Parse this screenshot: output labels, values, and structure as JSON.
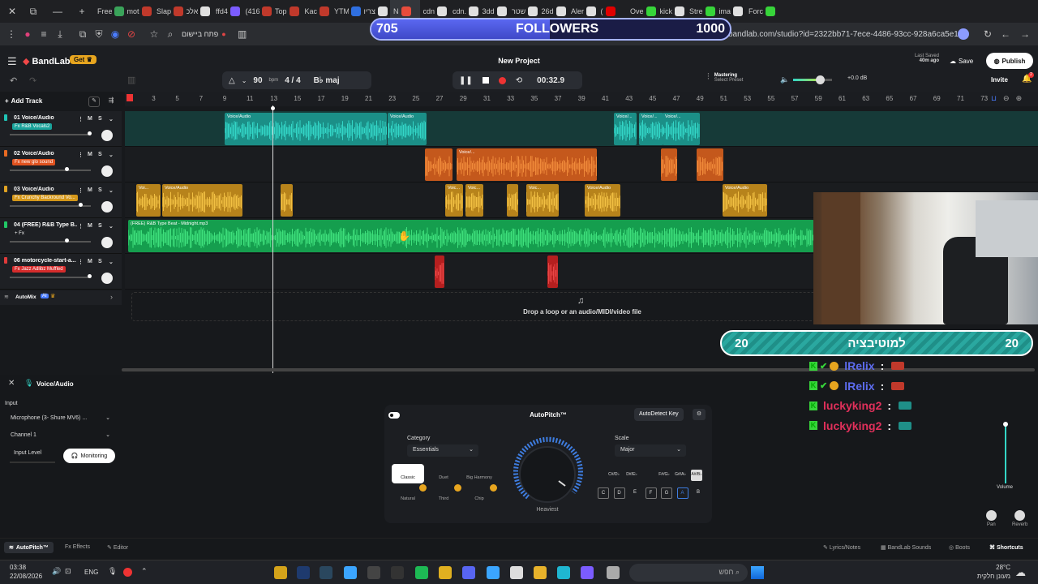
{
  "browser": {
    "tabs": [
      {
        "title": "",
        "color": "#555"
      },
      {
        "title": "",
        "color": "#555"
      },
      {
        "title": "",
        "color": "#555"
      },
      {
        "title": "",
        "color": "#555"
      },
      {
        "title": "Free",
        "color": "#3aa35a"
      },
      {
        "title": "mot",
        "color": "#c0392b"
      },
      {
        "title": "Slap",
        "color": "#c0392b"
      },
      {
        "title": "אלכ",
        "color": "#e0e0e0"
      },
      {
        "title": "ffd4",
        "color": "#7b5cff"
      },
      {
        "title": "(416",
        "color": "#c0392b"
      },
      {
        "title": "Top",
        "color": "#c0392b"
      },
      {
        "title": "Kac",
        "color": "#c0392b"
      },
      {
        "title": "YTM",
        "color": "#2f6fe0"
      },
      {
        "title": "צריו",
        "color": "#e0e0e0"
      },
      {
        "title": "N",
        "color": "#e74c3c"
      },
      {
        "title": "cdn",
        "color": "#e0e0e0"
      },
      {
        "title": "cdn.",
        "color": "#e0e0e0"
      },
      {
        "title": "3dd",
        "color": "#e0e0e0"
      },
      {
        "title": "שטר",
        "color": "#e0e0e0"
      },
      {
        "title": "26d",
        "color": "#e0e0e0"
      },
      {
        "title": "Aler",
        "color": "#e0e0e0"
      },
      {
        "title": "(",
        "color": "#e00000"
      },
      {
        "title": "Ove",
        "color": "#37d43a"
      },
      {
        "title": "kick",
        "color": "#e0e0e0"
      },
      {
        "title": "Stre",
        "color": "#37d43a"
      },
      {
        "title": "ima",
        "color": "#e0e0e0"
      },
      {
        "title": "Forc",
        "color": "#37d43a"
      }
    ],
    "install_app_label": "פתח ביישום",
    "url": "bandlab.com/studio?id=2322bb71-7ece-4486-93cc-928a6ca5e155"
  },
  "followers_overlay": {
    "current": "705",
    "label": "FOLLOWERS",
    "goal": "1000",
    "progress": 0.705
  },
  "header": {
    "logo": "BandLab",
    "get_label": "Get",
    "project_title": "New Project",
    "tempo": "90",
    "tempo_unit": "bpm",
    "time_signature": "4 / 4",
    "key": "B♭ maj",
    "time": "00:32.9",
    "mastering_label": "Mastering",
    "mastering_preset": "Select Preset",
    "volume_db": "+0.0 dB",
    "last_saved_label": "Last Saved",
    "last_saved_time": "40m ago",
    "save_label": "Save",
    "publish_label": "Publish",
    "invite_label": "Invite",
    "notification_count": "2"
  },
  "add_track_label": "Add Track",
  "ruler_marks": [
    "1",
    "3",
    "5",
    "7",
    "9",
    "11",
    "13",
    "15",
    "17",
    "19",
    "21",
    "23",
    "25",
    "27",
    "29",
    "31",
    "33",
    "35",
    "37",
    "39",
    "41",
    "43",
    "45",
    "47",
    "49",
    "51",
    "53",
    "55",
    "57",
    "59",
    "61",
    "63",
    "65",
    "67",
    "69",
    "71",
    "73"
  ],
  "tracks": [
    {
      "name": "01 Voice/Audio",
      "fx": "Fx R&B Vocals2",
      "fx_color": "#1aa39b",
      "color": "#20c4b6",
      "clip_color": "#1b8f87",
      "wave_color": "#33d6c7"
    },
    {
      "name": "02 Voice/Audio",
      "fx": "Fx new glo sound",
      "fx_color": "#e0521f",
      "color": "#e86a22",
      "clip_color": "#c4581c",
      "wave_color": "#f08a3a"
    },
    {
      "name": "03 Voice/Audio",
      "fx": "Fx Crunchy Backround Vo...",
      "fx_color": "#d4971a",
      "color": "#e0a323",
      "clip_color": "#b7831b",
      "wave_color": "#f2c043"
    },
    {
      "name": "04 (FREE) R&B Type B...",
      "fx": "+ Fx",
      "fx_color": "transparent",
      "color": "#21c766",
      "clip_color": "#159e4e",
      "wave_color": "#3ee07c"
    },
    {
      "name": "06 motorcycle-start-a...",
      "fx": "Fx Jazz Adlibz Muffled",
      "fx_color": "#d62c2c",
      "color": "#e03a3a",
      "clip_color": "#b51f1f",
      "wave_color": "#e84646"
    }
  ],
  "clip_labels": {
    "voice_audio": "Voice/Audio",
    "voice_audio_short_1": "Voice/...",
    "voice_audio_short_2": "Voice/...",
    "voi": "Voi...",
    "voic": "Voic...",
    "voice_dots": "Voice/...",
    "voice_lower": "Voic...",
    "beat_file": "(FREE) R&B Type Beat - Midnight.mp3"
  },
  "automix_label": "AutoMix",
  "automix_badge": "AI",
  "drop_zone_text": "Drop a loop or an audio/MIDI/video file",
  "bottom_panel": {
    "track_title": "Voice/Audio",
    "input_label": "Input",
    "input_device": "Microphone (3- Shure MV6) ...",
    "channel": "Channel 1",
    "input_level_label": "Input Level",
    "monitoring_label": "Monitoring",
    "autopitch_title": "AutoPitch™",
    "autodetect_label": "AutoDetect Key",
    "category_label": "Category",
    "category_value": "Essentials",
    "scale_label": "Scale",
    "scale_value": "Major",
    "knob_label": "Heaviest",
    "categories": [
      "Classic",
      "Duet",
      "Big Harmony",
      "Natural",
      "Third",
      "Chip"
    ],
    "keys_sharp": [
      "C#/D♭",
      "D#/E♭",
      "F#/G♭",
      "G#/A♭",
      "A#/B♭"
    ],
    "keys_natural": [
      "C",
      "D",
      "E",
      "F",
      "G",
      "A",
      "B"
    ],
    "volume_label": "Volume",
    "pan_label": "Pan",
    "reverb_label": "Reverb",
    "tabs": [
      "AutoPitch™",
      "Effects",
      "Editor"
    ],
    "bottom_right": [
      "Lyrics/Notes",
      "BandLab Sounds",
      "Boots",
      "Shortcuts"
    ]
  },
  "overlay_goal": {
    "left": "20",
    "title": "למוטיבציה",
    "right": "20"
  },
  "chat": [
    {
      "user": "lRelix",
      "color": "#5d6cf0"
    },
    {
      "user": "lRelix",
      "color": "#5d6cf0"
    },
    {
      "user": "luckyking2",
      "color": "#e1305b"
    },
    {
      "user": "luckyking2",
      "color": "#e1305b"
    }
  ],
  "taskbar": {
    "time": "03:38",
    "date": "22/08/2026",
    "lang": "ENG",
    "search_placeholder": "חפש",
    "weather_temp": "28°C",
    "weather_desc": "מעונן חלקית"
  }
}
